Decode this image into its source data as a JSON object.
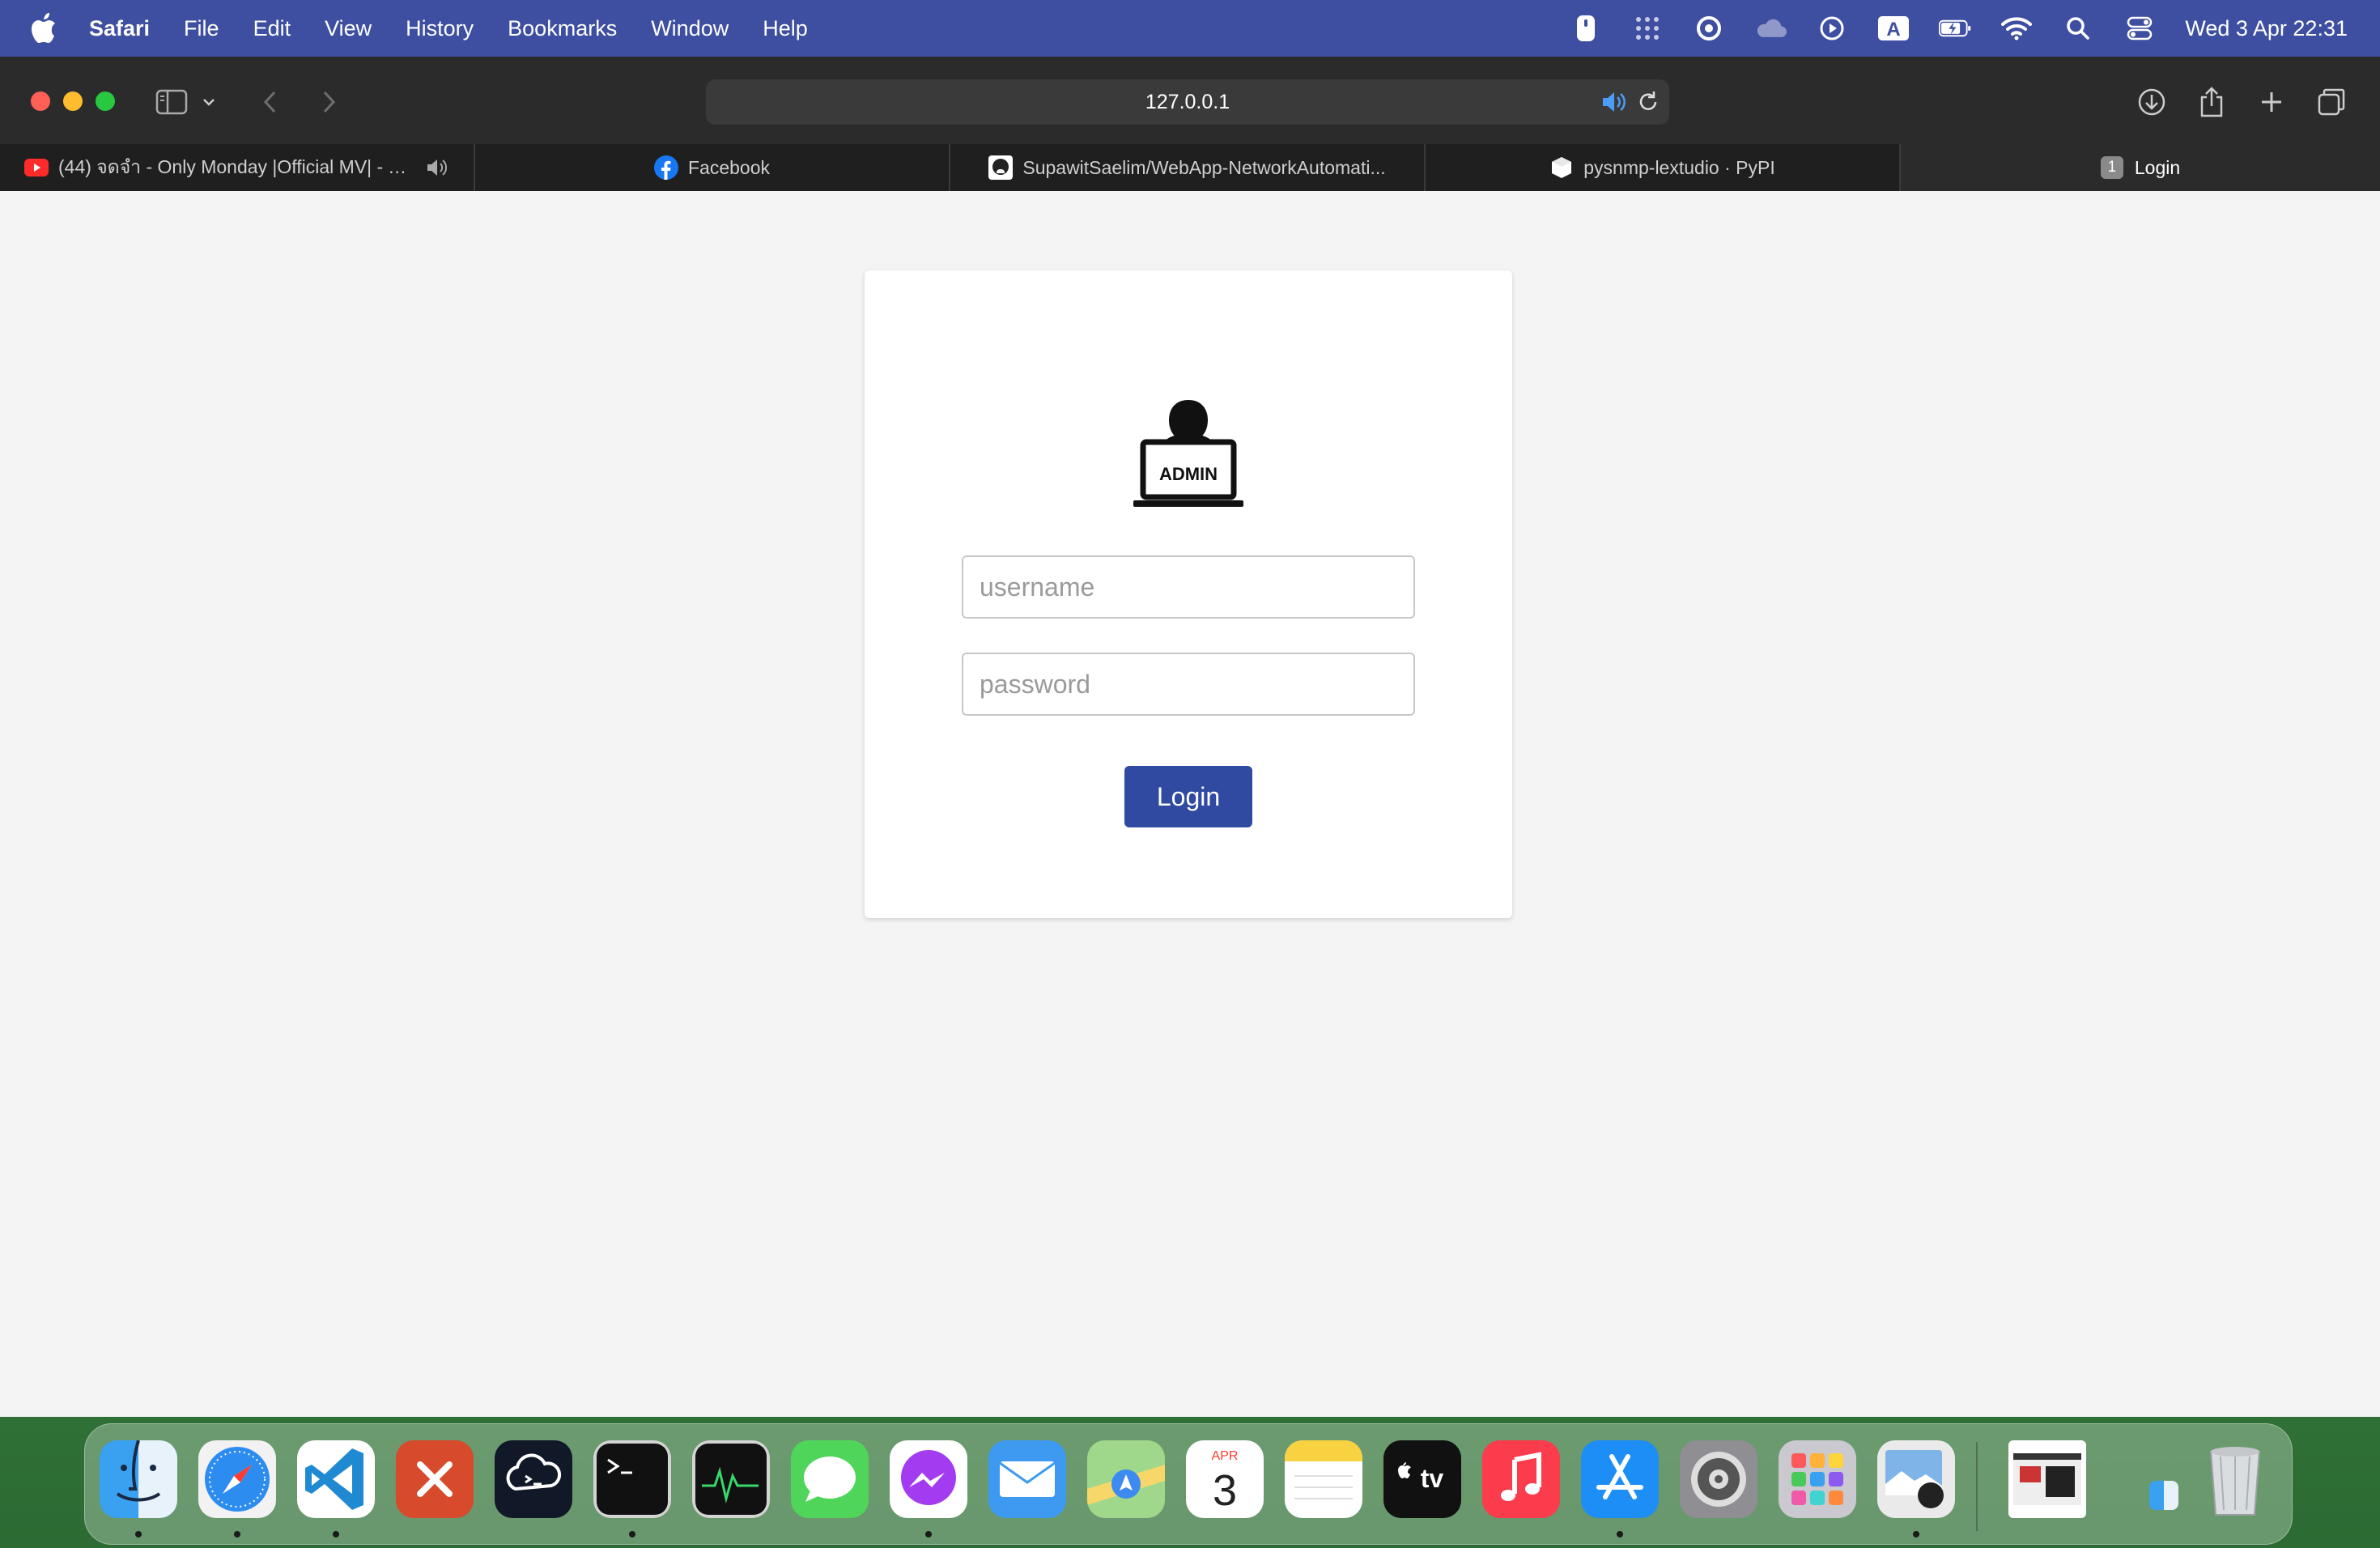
{
  "menubar": {
    "app_name": "Safari",
    "items": [
      "File",
      "Edit",
      "View",
      "History",
      "Bookmarks",
      "Window",
      "Help"
    ],
    "clock": "Wed 3 Apr  22:31",
    "keyboard_indicator": "A"
  },
  "browser": {
    "address": "127.0.0.1",
    "tabs": [
      {
        "title": "(44) จดจำ - Only Monday |Official MV| - Yo...",
        "icon": "youtube-icon"
      },
      {
        "title": "Facebook",
        "icon": "facebook-icon"
      },
      {
        "title": "SupawitSaelim/WebApp-NetworkAutomati...",
        "icon": "github-icon"
      },
      {
        "title": "pysnmp-lextudio · PyPI",
        "icon": "pypi-icon"
      },
      {
        "title": "Login",
        "badge": "1"
      }
    ]
  },
  "login": {
    "logo_text": "ADMIN",
    "username_placeholder": "username",
    "password_placeholder": "password",
    "button_label": "Login"
  },
  "dock": {
    "calendar_month": "APR",
    "calendar_day": "3",
    "tv_label": "tv",
    "apps": [
      "finder-icon",
      "safari-icon",
      "vscode-icon",
      "remote-desktop-icon",
      "chatgpt-icon",
      "terminal-icon",
      "activity-monitor-icon",
      "messages-icon",
      "messenger-icon",
      "mail-icon",
      "maps-icon",
      "calendar-icon",
      "notes-icon",
      "apple-tv-icon",
      "music-icon",
      "app-store-icon",
      "system-settings-icon",
      "launchpad-icon",
      "preview-icon",
      "window-thumbnail",
      "finder-small-icon",
      "trash-icon"
    ]
  }
}
